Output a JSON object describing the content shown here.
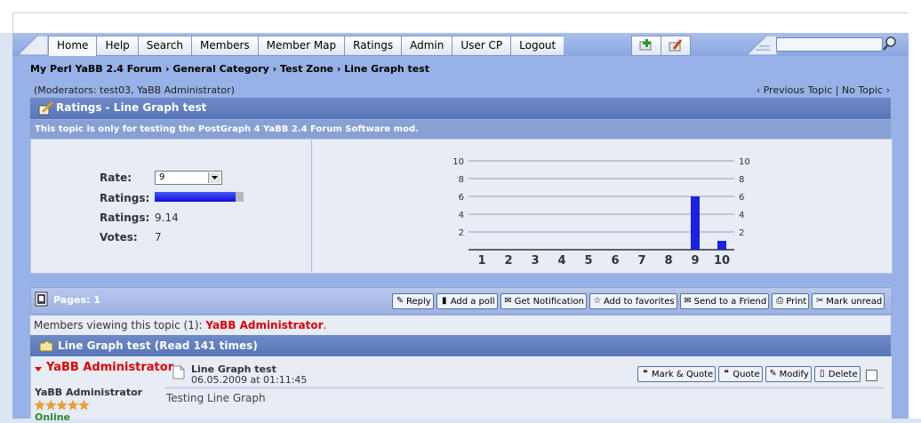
{
  "nav": {
    "tabs": [
      "Home",
      "Help",
      "Search",
      "Members",
      "Member Map",
      "Ratings",
      "Admin",
      "User CP",
      "Logout"
    ],
    "search_placeholder": ""
  },
  "breadcrumb": [
    "My Perl YaBB 2.4 Forum",
    "General Category",
    "Test Zone",
    "Line Graph test"
  ],
  "moderators_text": "(Moderators: test03, YaBB Administrator)",
  "topic_nav": {
    "previous": "‹ Previous Topic",
    "separator": "|",
    "next": "No Topic ›"
  },
  "ratings_header": "Ratings - Line Graph test",
  "ratings_subheader": "This topic is only for testing the PostGraph 4 YaBB 2.4 Forum Software mod.",
  "ratings": {
    "rate_label": "Rate:",
    "rate_selected": "9",
    "ratings_bar_label": "Ratings:",
    "ratings_bar_fraction": 0.914,
    "ratings_label": "Ratings:",
    "ratings_value": "9.14",
    "votes_label": "Votes:",
    "votes_value": "7"
  },
  "chart_data": {
    "type": "bar",
    "categories": [
      "1",
      "2",
      "3",
      "4",
      "5",
      "6",
      "7",
      "8",
      "9",
      "10"
    ],
    "values": [
      0,
      0,
      0,
      0,
      0,
      0,
      0,
      0,
      6,
      1
    ],
    "ylim": [
      0,
      10
    ],
    "yticks": [
      2,
      4,
      6,
      8,
      10
    ],
    "grid": true,
    "color": "#1a22e0",
    "title": "",
    "xlabel": "",
    "ylabel": ""
  },
  "toolbar": {
    "pages_label": "Pages: 1",
    "buttons": [
      {
        "label": "Reply",
        "icon": "reply-icon"
      },
      {
        "label": "Add a poll",
        "icon": "poll-icon"
      },
      {
        "label": "Get Notification",
        "icon": "notify-icon"
      },
      {
        "label": "Add to favorites",
        "icon": "favorites-icon"
      },
      {
        "label": "Send to a Friend",
        "icon": "send-icon"
      },
      {
        "label": "Print",
        "icon": "print-icon"
      },
      {
        "label": "Mark unread",
        "icon": "mark-unread-icon"
      }
    ]
  },
  "viewers": {
    "prefix": "Members viewing this topic (1): ",
    "name": "YaBB Administrator",
    "suffix": "."
  },
  "thread_header": "Line Graph test (Read 141 times)",
  "post": {
    "username": "YaBB Administrator",
    "user_title": "YaBB Administrator",
    "stars": "★★★★★",
    "status": "Online",
    "title": "Line Graph test",
    "date": "06.05.2009 at 01:11:45",
    "body": "Testing Line Graph",
    "buttons": [
      "Mark & Quote",
      "Quote",
      "Modify",
      "Delete"
    ]
  }
}
